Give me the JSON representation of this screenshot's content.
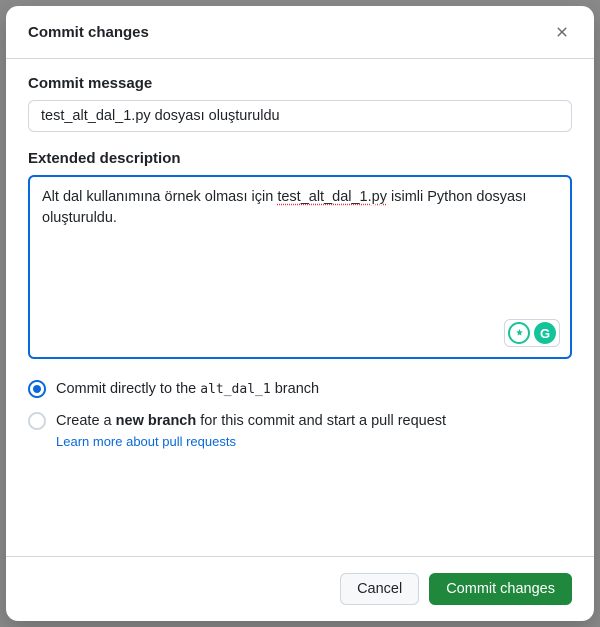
{
  "dialog": {
    "title": "Commit changes"
  },
  "commit_message": {
    "label": "Commit message",
    "value": "test_alt_dal_1.py dosyası oluşturuldu"
  },
  "extended_description": {
    "label": "Extended description",
    "value_prefix": "Alt dal kullanımına örnek olması için ",
    "value_marked": "test_alt_dal_1.py",
    "value_suffix": " isimli Python dosyası oluşturuldu."
  },
  "radio_options": {
    "direct": {
      "prefix": "Commit directly to the ",
      "branch": "alt_dal_1",
      "suffix": " branch",
      "checked": true
    },
    "new_branch": {
      "prefix": "Create a ",
      "bold": "new branch",
      "suffix": " for this commit and start a pull request",
      "checked": false
    },
    "learn_more": "Learn more about pull requests"
  },
  "footer": {
    "cancel": "Cancel",
    "commit": "Commit changes"
  },
  "icons": {
    "close": "close-icon",
    "grammarly_bulb": "bulb-icon",
    "grammarly_g": "G"
  }
}
